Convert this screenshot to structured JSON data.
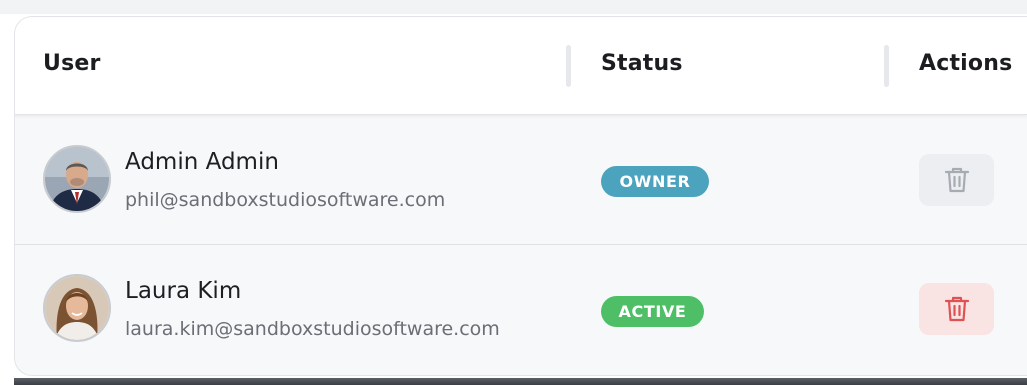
{
  "table": {
    "columns": {
      "user": "User",
      "status": "Status",
      "actions": "Actions"
    },
    "rows": [
      {
        "name": "Admin Admin",
        "email": "phil@sandboxstudiosoftware.com",
        "status": "OWNER",
        "status_color": "#4ba3bd",
        "delete_enabled": false,
        "delete_icon": "trash-icon"
      },
      {
        "name": "Laura Kim",
        "email": "laura.kim@sandboxstudiosoftware.com",
        "status": "ACTIVE",
        "status_color": "#4fbf67",
        "delete_enabled": true,
        "delete_icon": "trash-icon"
      }
    ]
  },
  "colors": {
    "danger": "#e05252",
    "disabled_icon": "#a7abb2"
  }
}
